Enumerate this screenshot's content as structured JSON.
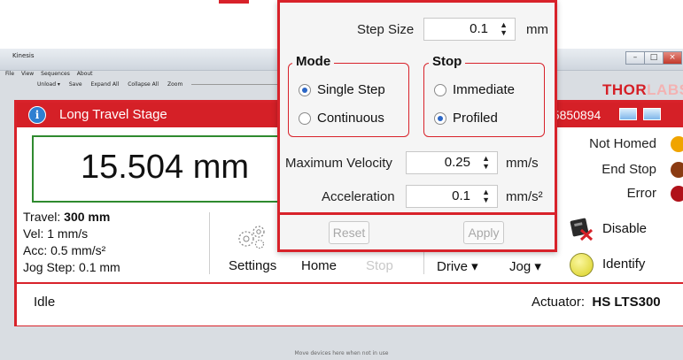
{
  "window": {
    "title": "Kinesis"
  },
  "menu": [
    "File",
    "View",
    "Sequences",
    "About"
  ],
  "toolbar": {
    "unload": "Unload ▾",
    "save": "Save",
    "expand_all": "Expand All",
    "collapse_all": "Collapse All",
    "zoom": "Zoom"
  },
  "brand": {
    "logo_main": "THOR",
    "logo_tail": "LABS"
  },
  "device": {
    "title": "Long Travel Stage",
    "serial": "45850894",
    "position": "15.504 mm",
    "travel_label": "Travel: ",
    "travel_value": "300 mm",
    "vel": "Vel: 1 mm/s",
    "acc": "Acc: 0.5 mm/s²",
    "jog_step": "Jog Step: 0.1 mm",
    "buttons": {
      "settings": "Settings",
      "home": "Home",
      "stop": "Stop",
      "drive": "Drive ▾",
      "jog": "Jog ▾",
      "disable": "Disable",
      "identify": "Identify"
    },
    "status_labels": {
      "not_homed": "Not Homed",
      "end_stop": "End Stop",
      "error": "Error"
    },
    "status": "Idle",
    "actuator_label": "Actuator:",
    "actuator_value": "HS LTS300"
  },
  "popup": {
    "step_size_label": "Step Size",
    "step_size_value": "0.1",
    "step_size_unit": "mm",
    "mode_title": "Mode",
    "mode_options": [
      "Single Step",
      "Continuous"
    ],
    "mode_selected": "Single Step",
    "stop_title": "Stop",
    "stop_options": [
      "Immediate",
      "Profiled"
    ],
    "stop_selected": "Profiled",
    "max_velocity_label": "Maximum Velocity",
    "max_velocity_value": "0.25",
    "max_velocity_unit": "mm/s",
    "acceleration_label": "Acceleration",
    "acceleration_value": "0.1",
    "acceleration_unit": "mm/s²",
    "reset": "Reset",
    "apply": "Apply"
  },
  "footer_hint": "Move devices here when not in use",
  "colors": {
    "accent": "#d8222a",
    "led_yellow": "#f0a400",
    "led_brown": "#8b3b12",
    "led_red": "#b0121a",
    "position_border": "#2f8a2f"
  }
}
